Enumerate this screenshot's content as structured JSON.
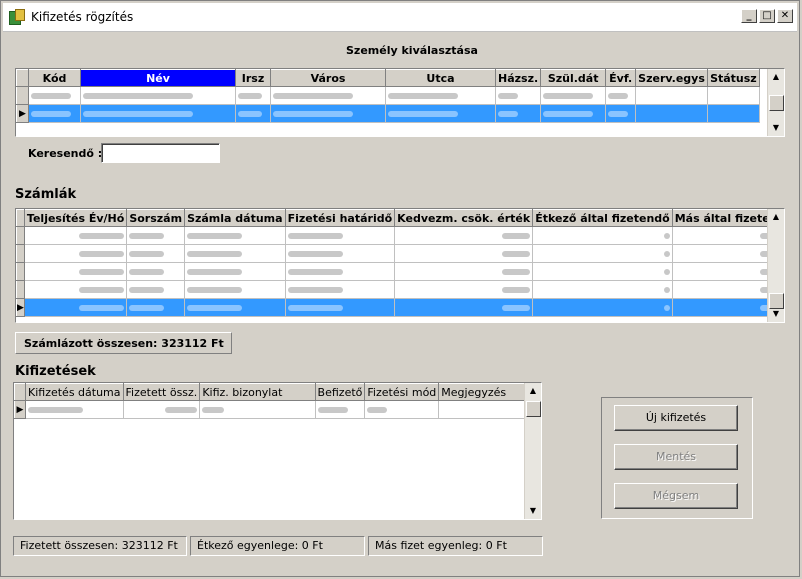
{
  "window": {
    "title": "Kifizetés rögzítés",
    "minimize": "_",
    "maximize": "□",
    "close": "✕"
  },
  "person": {
    "section_title": "Személy kiválasztása",
    "columns": [
      "Kód",
      "Név",
      "Irsz",
      "Város",
      "Utca",
      "Házsz.",
      "Szül.dát",
      "Évf.",
      "Szerv.egys",
      "Státusz"
    ],
    "search_label": "Keresendő :",
    "search_value": ""
  },
  "invoices": {
    "title": "Számlák",
    "columns": [
      "Teljesítés Év/Hó",
      "Sorszám",
      "Számla dátuma",
      "Fizetési határidő",
      "Kedvezm. csök. érték",
      "Étkező által fizetendő",
      "Más által fizetendő"
    ],
    "partial_values": [
      "6",
      "0",
      "4",
      "0",
      "0"
    ],
    "total_label": "Számlázott összesen: 323112 Ft"
  },
  "payments": {
    "title": "Kifizetések",
    "columns": [
      "Kifizetés dátuma",
      "Fizetett össz.",
      "Kifiz. bizonylat",
      "Befizető",
      "Fizetési mód",
      "Megjegyzés"
    ]
  },
  "buttons": {
    "new_payment": "Új kifizetés",
    "save": "Mentés",
    "cancel": "Mégsem"
  },
  "status": {
    "paid_total": "Fizetett összesen: 323112 Ft",
    "diner_balance": "Étkező egyenlege: 0 Ft",
    "other_balance": "Más fizet egyenleg: 0 Ft"
  }
}
